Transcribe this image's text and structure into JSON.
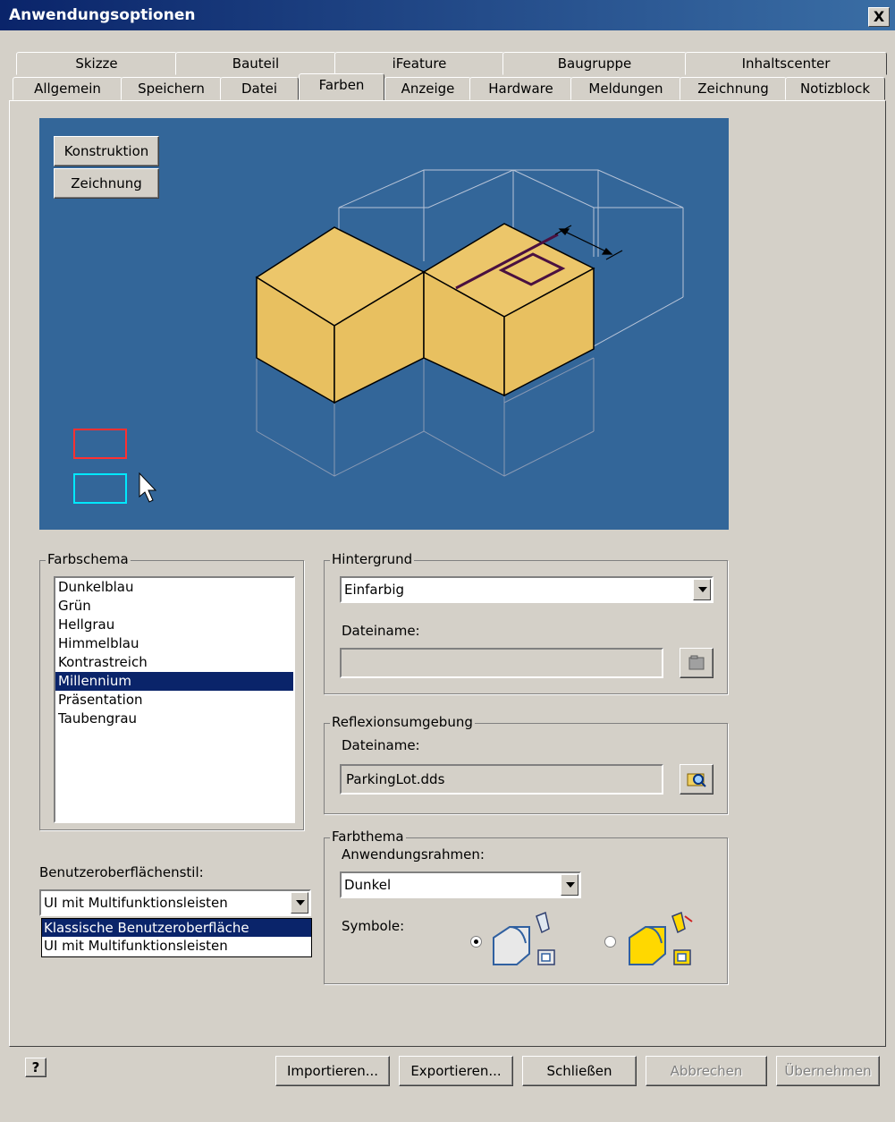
{
  "window": {
    "title": "Anwendungsoptionen",
    "close_glyph": "X"
  },
  "tabs": {
    "row1": [
      "Skizze",
      "Bauteil",
      "iFeature",
      "Baugruppe",
      "Inhaltscenter"
    ],
    "row2": [
      "Allgemein",
      "Speichern",
      "Datei",
      "Farben",
      "Anzeige",
      "Hardware",
      "Meldungen",
      "Zeichnung",
      "Notizblock"
    ],
    "active": "Farben"
  },
  "preview": {
    "btn_construction": "Konstruktion",
    "btn_drawing": "Zeichnung",
    "background_color": "#336699",
    "part_color": "#e8c060"
  },
  "color_scheme": {
    "legend": "Farbschema",
    "items": [
      "Dunkelblau",
      "Grün",
      "Hellgrau",
      "Himmelblau",
      "Kontrastreich",
      "Millennium",
      "Präsentation",
      "Taubengrau"
    ],
    "selected": "Millennium"
  },
  "ui_style": {
    "label": "Benutzeroberflächenstil:",
    "value": "UI mit Multifunktionsleisten",
    "options": [
      "Klassische Benutzeroberfläche",
      "UI mit Multifunktionsleisten"
    ],
    "highlighted": "Klassische Benutzeroberfläche"
  },
  "background": {
    "legend": "Hintergrund",
    "value": "Einfarbig",
    "file_label": "Dateiname:",
    "file_value": ""
  },
  "reflection": {
    "legend": "Reflexionsumgebung",
    "file_label": "Dateiname:",
    "file_value": "ParkingLot.dds"
  },
  "theme": {
    "legend": "Farbthema",
    "frame_label": "Anwendungsrahmen:",
    "frame_value": "Dunkel",
    "icons_label": "Symbole:",
    "icon_selected_index": 0
  },
  "footer": {
    "help_glyph": "?",
    "import": "Importieren...",
    "export": "Exportieren...",
    "close": "Schließen",
    "cancel": "Abbrechen",
    "apply": "Übernehmen"
  }
}
